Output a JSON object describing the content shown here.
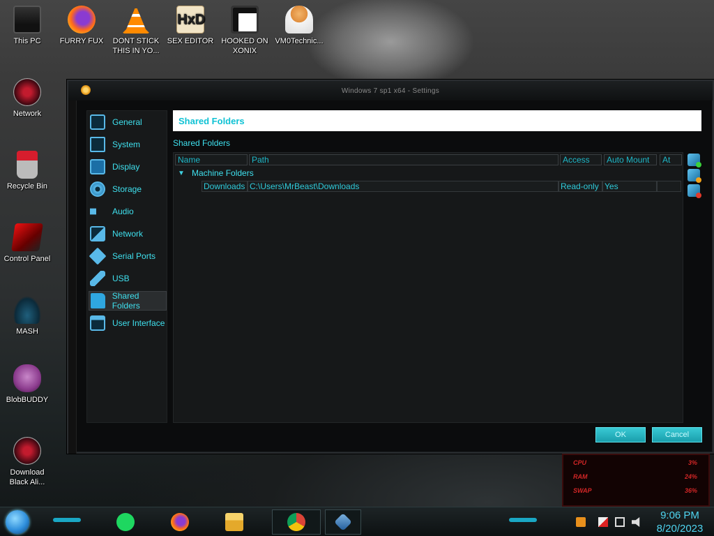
{
  "desktop": {
    "icons": [
      {
        "label": "This PC",
        "icon": "computer-icon"
      },
      {
        "label": "FURRY FUX",
        "icon": "firefox-icon"
      },
      {
        "label": "DONT STICK THIS IN YO...",
        "icon": "vlc-cone-icon"
      },
      {
        "label": "SEX EDITOR",
        "icon": "hxd-icon"
      },
      {
        "label": "HOOKED ON XONIX",
        "icon": "xonix-icon"
      },
      {
        "label": "VM0Technic...",
        "icon": "doctor-icon"
      },
      {
        "label": "Network",
        "icon": "network-orb-icon"
      },
      {
        "label": "Recycle Bin",
        "icon": "recycle-bin-icon"
      },
      {
        "label": "Control Panel",
        "icon": "control-panel-icon"
      },
      {
        "label": "MASH",
        "icon": "mash-icon"
      },
      {
        "label": "BlobBUDDY",
        "icon": "bonzi-icon"
      },
      {
        "label": "Download Black Ali...",
        "icon": "download-orb-icon"
      }
    ]
  },
  "window": {
    "title": "Windows 7 sp1 x64 - Settings",
    "nav": [
      {
        "label": "General",
        "icon": "monitor-icon"
      },
      {
        "label": "System",
        "icon": "chip-icon"
      },
      {
        "label": "Display",
        "icon": "display-icon"
      },
      {
        "label": "Storage",
        "icon": "disc-icon"
      },
      {
        "label": "Audio",
        "icon": "speaker-icon"
      },
      {
        "label": "Network",
        "icon": "network-icon"
      },
      {
        "label": "Serial Ports",
        "icon": "serial-port-icon"
      },
      {
        "label": "USB",
        "icon": "usb-icon"
      },
      {
        "label": "Shared Folders",
        "icon": "folder-icon"
      },
      {
        "label": "User Interface",
        "icon": "window-icon"
      }
    ],
    "active_nav": "Shared Folders",
    "page_title": "Shared Folders",
    "section_label": "Shared Folders",
    "table": {
      "columns": [
        "Name",
        "Path",
        "Access",
        "Auto Mount",
        "At"
      ],
      "group": "Machine Folders",
      "rows": [
        {
          "name": "Downloads",
          "path": "C:\\Users\\MrBeast\\Downloads",
          "access": "Read-only",
          "auto_mount": "Yes",
          "at": ""
        }
      ]
    },
    "tools": [
      "add-folder-icon",
      "edit-folder-icon",
      "remove-folder-icon"
    ],
    "ok_label": "OK",
    "cancel_label": "Cancel"
  },
  "gadget": {
    "rows": [
      {
        "label": "CPU",
        "value": "3%"
      },
      {
        "label": "RAM",
        "value": "24%"
      },
      {
        "label": "SWAP",
        "value": "36%"
      }
    ]
  },
  "taskbar": {
    "apps": [
      "spotify-icon",
      "firefox-icon",
      "file-explorer-icon",
      "chrome-icon",
      "virtualbox-icon"
    ],
    "tray": [
      "action-center-icon",
      "flag-icon",
      "network-tray-icon",
      "volume-icon"
    ],
    "time": "9:06 PM",
    "date": "8/20/2023"
  },
  "colors": {
    "accent": "#3fe0ee",
    "button": "#1fb0bd",
    "gadget_red": "#d22626",
    "clock": "#4fd4f0"
  }
}
